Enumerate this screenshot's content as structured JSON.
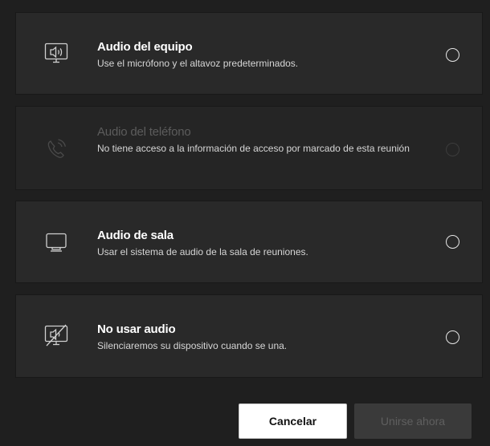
{
  "options": [
    {
      "title": "Audio del equipo",
      "description": "Use el micrófono y el altavoz predeterminados.",
      "icon": "computer-audio-icon",
      "disabled": false,
      "selected": false
    },
    {
      "title": "Audio del teléfono",
      "description": "No tiene acceso a la información de acceso por marcado de esta reunión",
      "icon": "phone-audio-icon",
      "disabled": true,
      "selected": false
    },
    {
      "title": "Audio de sala",
      "description": "Usar el sistema de audio de la sala de reuniones.",
      "icon": "room-audio-icon",
      "disabled": false,
      "selected": false
    },
    {
      "title": "No usar audio",
      "description": "Silenciaremos su dispositivo cuando se una.",
      "icon": "no-audio-icon",
      "disabled": false,
      "selected": false
    }
  ],
  "buttons": {
    "cancel_label": "Cancelar",
    "join_label": "Unirse ahora",
    "join_disabled": true
  },
  "colors": {
    "background": "#1f1f1f",
    "card": "#292929",
    "text": "#ffffff",
    "muted": "#5c5c5c"
  }
}
